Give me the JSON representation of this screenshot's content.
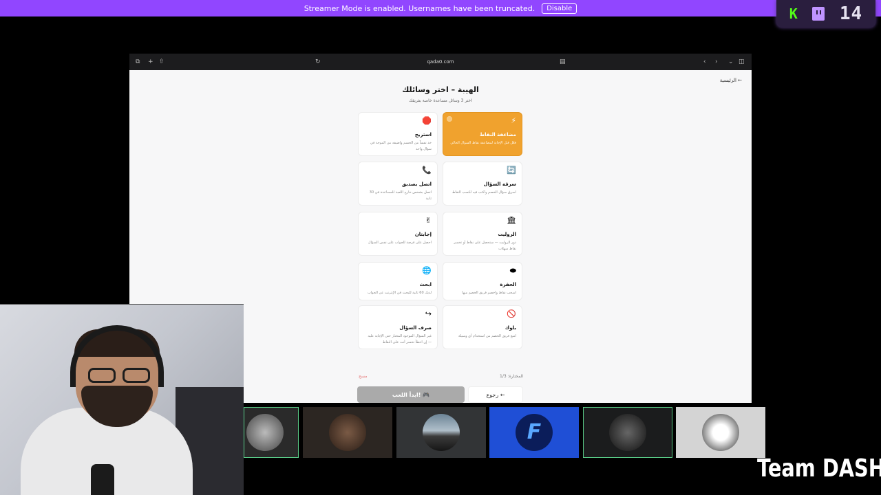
{
  "banner": {
    "text": "Streamer Mode is enabled. Usernames have been truncated.",
    "button": "Disable"
  },
  "counter": {
    "k_label": "K",
    "value": "14"
  },
  "browser": {
    "url": "qada0.com"
  },
  "page": {
    "home": "الرئيسية ←",
    "title": "الهيبة – اختر وسائلك",
    "subtitle": "اختر 3 وسائل مساعدة خاصة بفريقك",
    "cards": [
      {
        "icon": "⚡",
        "name": "مضاعفة النقاط",
        "desc": "فعّل قبل الإجابة لمضاعفة نقاط السؤال الحالي",
        "selected": true
      },
      {
        "icon": "🛑",
        "name": "استريح",
        "desc": "خذ نفساً من الحسم واضيفه من الموجة في سؤال واحد",
        "selected": false
      },
      {
        "icon": "🔄",
        "name": "سرقة السؤال",
        "desc": "اسرق سؤال الخصم واكتب فيه لكسب النقاط",
        "selected": false
      },
      {
        "icon": "📞",
        "name": "اتصل بصديق",
        "desc": "اتصل بشخص خارج اللعبة للمساعدة في 30 ثانية",
        "selected": false
      },
      {
        "icon": "🏛",
        "name": "الروليت",
        "desc": "دور الروليت — ستحصل على نقاط أو تخسر نقاط سهلات",
        "selected": false
      },
      {
        "icon": "✌",
        "name": "إجابتان",
        "desc": "احصل على فرصة للجواب على نفس السؤال",
        "selected": false
      },
      {
        "icon": "⬬",
        "name": "الحفرة",
        "desc": "اسحب نقاط واخصم فريق الخصم منها",
        "selected": false
      },
      {
        "icon": "🌐",
        "name": "ابحث",
        "desc": "لديك 60 ثانية للبحث في الإنترنت عن الجواب",
        "selected": false
      },
      {
        "icon": "🚫",
        "name": "بلوك",
        "desc": "امنع فريق الخصم من استخدام أي وسيلة",
        "selected": false
      },
      {
        "icon": "↪",
        "name": "صرف السؤال",
        "desc": "غير السؤال الموجود المختار حتى الإجابة عليه — إن اخطأ تخسر أنت على النقاط",
        "selected": false
      }
    ],
    "selected_count": "المختارة: 1/3",
    "clear": "مسح",
    "start_button": "ابدأ اللعب! 🎮",
    "back_button": "رجوع ←"
  },
  "team_logo": "Team DASH",
  "colors": {
    "banner": "#9146ff",
    "selected_card": "#f0a22e",
    "kick_green": "#53fc18"
  }
}
